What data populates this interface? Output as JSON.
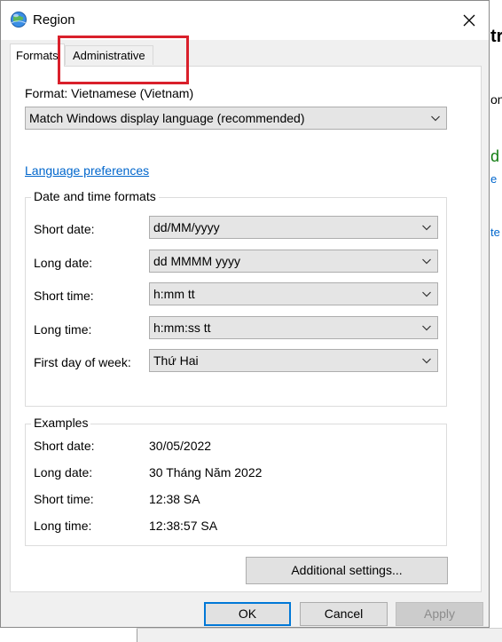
{
  "window": {
    "title": "Region"
  },
  "tabs": [
    {
      "label": "Formats",
      "active": true
    },
    {
      "label": "Administrative",
      "active": false
    }
  ],
  "formats": {
    "format_label": "Format: Vietnamese (Vietnam)",
    "format_value": "Match Windows display language (recommended)",
    "language_link": "Language preferences"
  },
  "date_time_formats": {
    "group_title": "Date and time formats",
    "fields": [
      {
        "label": "Short date:",
        "value": "dd/MM/yyyy"
      },
      {
        "label": "Long date:",
        "value": "dd MMMM yyyy"
      },
      {
        "label": "Short time:",
        "value": "h:mm tt"
      },
      {
        "label": "Long time:",
        "value": "h:mm:ss tt"
      },
      {
        "label": "First day of week:",
        "value": "Thứ Hai"
      }
    ]
  },
  "examples": {
    "group_title": "Examples",
    "rows": [
      {
        "label": "Short date:",
        "value": "30/05/2022"
      },
      {
        "label": "Long date:",
        "value": "30 Tháng Năm 2022"
      },
      {
        "label": "Short time:",
        "value": "12:38 SA"
      },
      {
        "label": "Long time:",
        "value": "12:38:57 SA"
      }
    ]
  },
  "buttons": {
    "additional": "Additional settings...",
    "ok": "OK",
    "cancel": "Cancel",
    "apply": "Apply"
  },
  "background_window": {
    "fragments": [
      "tr",
      "on",
      "d",
      "e",
      "te"
    ]
  },
  "colors": {
    "highlight": "#d9202b",
    "link": "#0066cc",
    "focus": "#0078d7"
  },
  "icons": {
    "app": "globe-icon",
    "close": "close-icon",
    "dropdown": "chevron-down-icon"
  }
}
